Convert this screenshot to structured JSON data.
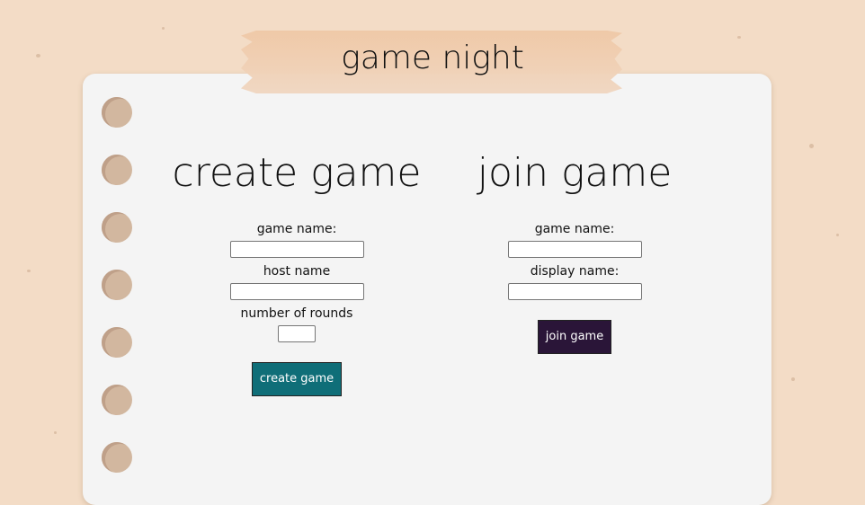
{
  "header": {
    "title": "game night"
  },
  "create": {
    "title": "create game",
    "game_name_label": "game name:",
    "host_name_label": "host name",
    "rounds_label": "number of rounds",
    "game_name_value": "",
    "host_name_value": "",
    "rounds_value": "",
    "button_label": "create game",
    "button_color": "#0f6e78"
  },
  "join": {
    "title": "join game",
    "game_name_label": "game name:",
    "display_name_label": "display name:",
    "game_name_value": "",
    "display_name_value": "",
    "button_label": "join game",
    "button_color": "#2a1538"
  },
  "colors": {
    "background": "#f3dcc6",
    "paper": "#f4f4f4",
    "tape": "#efc8a6",
    "hole": "#d2b79f"
  }
}
